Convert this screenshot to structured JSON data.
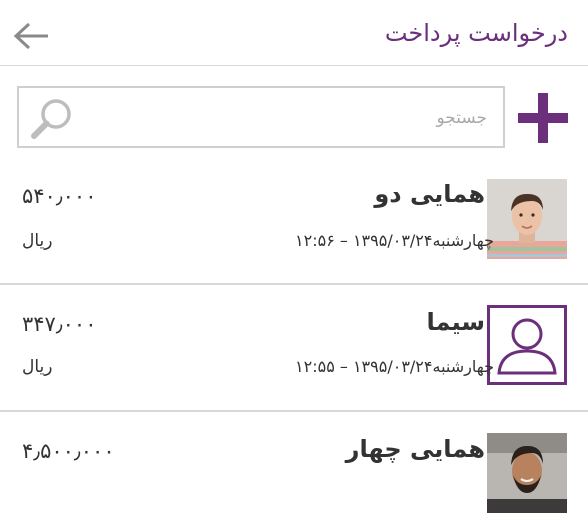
{
  "header": {
    "title": "درخواست پرداخت",
    "back_icon": "arrow-left-icon"
  },
  "search": {
    "placeholder": "جستجو",
    "value": "",
    "icon": "search-icon"
  },
  "toolbar": {
    "add_icon": "plus-icon",
    "accent_color": "#6b2f7c"
  },
  "requests": [
    {
      "name": "همایی دو",
      "date": "چهارشنبه۱۳۹۵/۰۳/۲۴ – ۱۲:۵۶",
      "amount": "۵۴۰٫۰۰۰",
      "currency": "ریال",
      "avatar": "photo-young-man"
    },
    {
      "name": "سیما",
      "date": "چهارشنبه۱۳۹۵/۰۳/۲۴ – ۱۲:۵۵",
      "amount": "۳۴۷٫۰۰۰",
      "currency": "ریال",
      "avatar": "user-placeholder-icon"
    },
    {
      "name": "همایی چهار",
      "date": "",
      "amount": "۴٫۵۰۰٫۰۰۰",
      "currency": "",
      "avatar": "photo-bearded-man"
    }
  ]
}
